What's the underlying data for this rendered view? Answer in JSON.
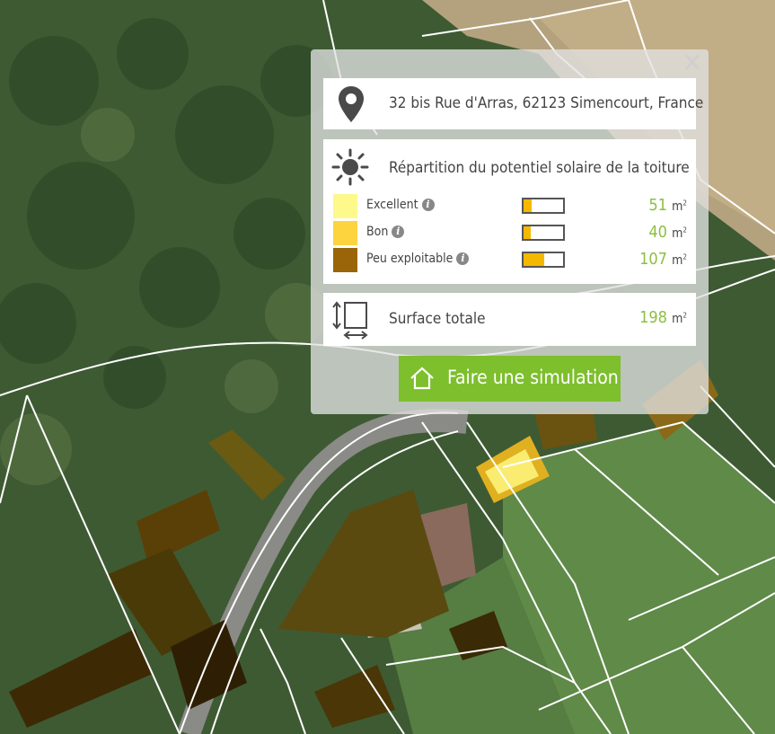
{
  "address": {
    "text": "32 bis Rue d'Arras, 62123 Simencourt, France",
    "icon": "map-pin-icon"
  },
  "solar": {
    "title": "Répartition du potentiel solaire de la toiture",
    "icon": "sun-icon",
    "rows": [
      {
        "label": "Excellent",
        "value": "51",
        "unit": "m",
        "color": "#fdf98a",
        "fraction": 0.2
      },
      {
        "label": "Bon",
        "value": "40",
        "unit": "m",
        "color": "#fdd43e",
        "fraction": 0.18
      },
      {
        "label": "Peu exploitable",
        "value": "107",
        "unit": "m",
        "color": "#9a6408",
        "fraction": 0.52
      }
    ],
    "info_glyph": "i"
  },
  "total": {
    "label": "Surface totale",
    "value": "198",
    "unit": "m",
    "icon": "area-dimensions-icon"
  },
  "simulate_button": {
    "label": "Faire une simulation",
    "icon": "house-icon"
  },
  "close_glyph": "✕",
  "colors": {
    "accent": "#7dbf2c",
    "value_green": "#8cbf3f"
  }
}
